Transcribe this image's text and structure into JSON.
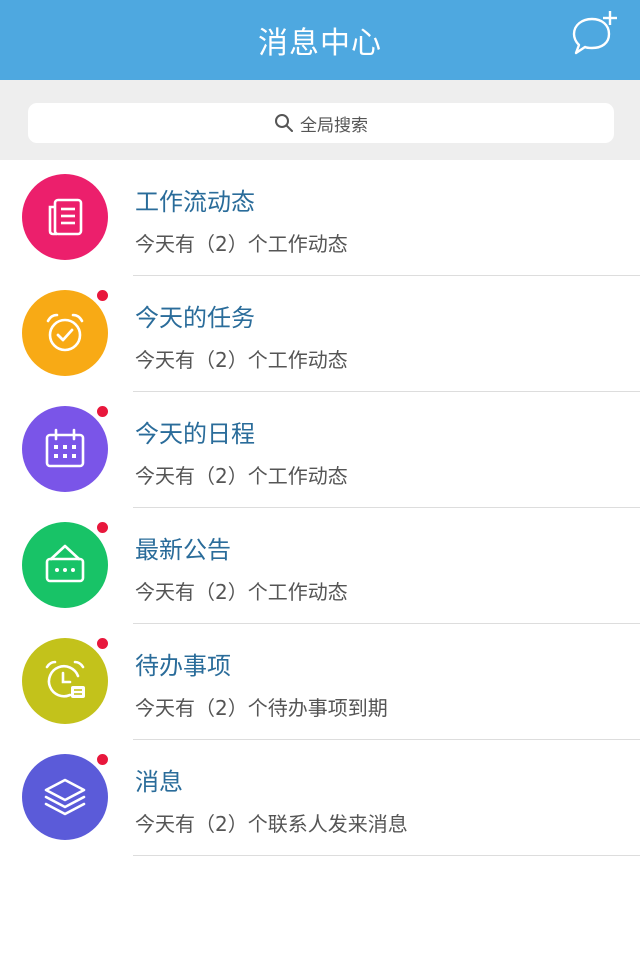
{
  "header": {
    "title": "消息中心",
    "compose_icon": "chat-bubble-plus-icon"
  },
  "search": {
    "label": "全局搜索",
    "icon": "search-icon"
  },
  "colors": {
    "header_bg": "#4ea8e0",
    "badge": "#e8173c",
    "title_text": "#2a6c9a"
  },
  "items": [
    {
      "title": "工作流动态",
      "subtitle": "今天有（2）个工作动态",
      "icon": "document-list-icon",
      "color": "#ec1f6c",
      "unread": false
    },
    {
      "title": "今天的任务",
      "subtitle": "今天有（2）个工作动态",
      "icon": "alarm-clock-check-icon",
      "color": "#f8aa15",
      "unread": true
    },
    {
      "title": "今天的日程",
      "subtitle": "今天有（2）个工作动态",
      "icon": "calendar-icon",
      "color": "#7a55e8",
      "unread": true
    },
    {
      "title": "最新公告",
      "subtitle": "今天有（2）个工作动态",
      "icon": "notice-board-icon",
      "color": "#18c367",
      "unread": true
    },
    {
      "title": "待办事项",
      "subtitle": "今天有（2）个待办事项到期",
      "icon": "clock-card-icon",
      "color": "#c3c21b",
      "unread": true
    },
    {
      "title": "消息",
      "subtitle": "今天有（2）个联系人发来消息",
      "icon": "layers-icon",
      "color": "#5b5bd9",
      "unread": true
    }
  ]
}
